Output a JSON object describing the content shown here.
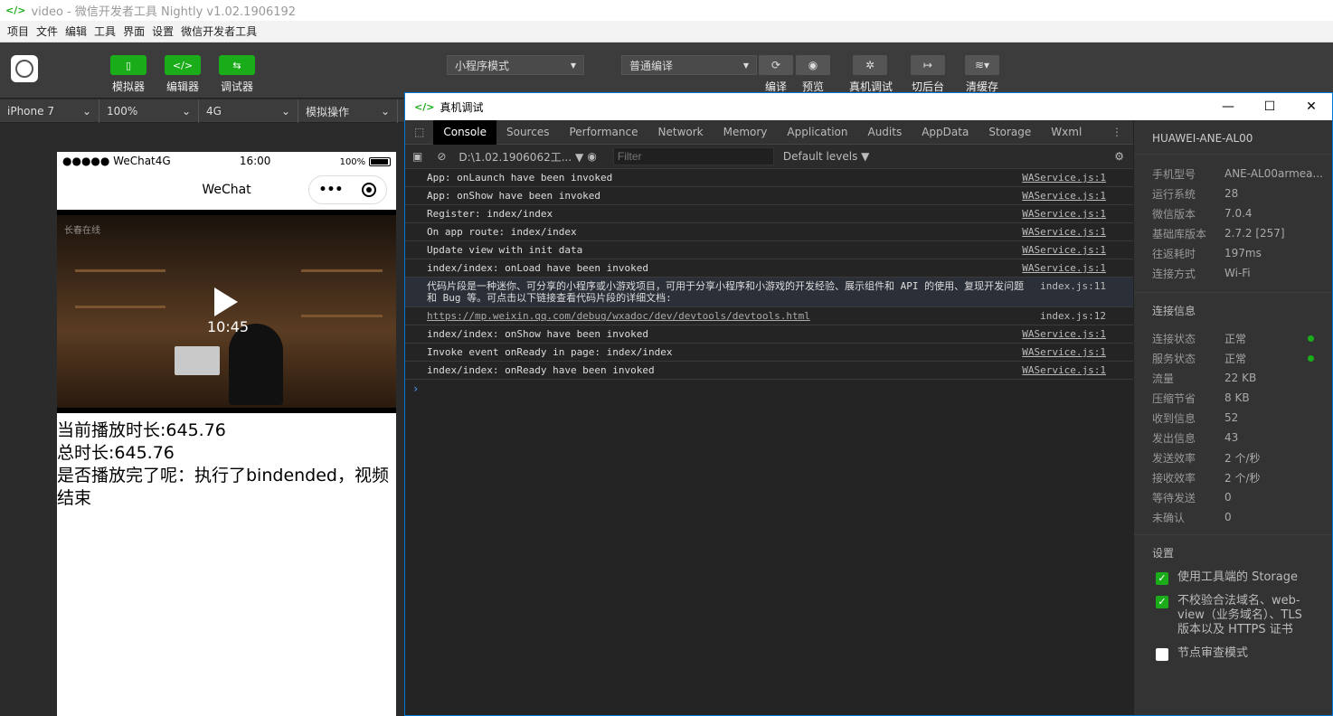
{
  "window": {
    "title": "video - 微信开发者工具 Nightly v1.02.1906192"
  },
  "menu": [
    "项目",
    "文件",
    "编辑",
    "工具",
    "界面",
    "设置",
    "微信开发者工具"
  ],
  "toolbar": {
    "simulator": "模拟器",
    "editor": "编辑器",
    "debugger": "调试器",
    "mode": "小程序模式",
    "compile_mode": "普通编译",
    "compile": "编译",
    "preview": "预览",
    "remote_debug": "真机调试",
    "background": "切后台",
    "clear_cache": "清缓存"
  },
  "device_bar": {
    "device": "iPhone 7",
    "zoom": "100%",
    "network": "4G",
    "simulate": "模拟操作"
  },
  "phone": {
    "status_left": "●●●●● WeChat4G",
    "time": "16:00",
    "battery": "100%",
    "nav_title": "WeChat",
    "capsule_dots": "•••",
    "video_watermark": "长春在线",
    "video_time": "10:45",
    "lines": [
      "当前播放时长:645.76",
      "总时长:645.76",
      "是否播放完了呢：执行了bindended，视频结束"
    ]
  },
  "devtools": {
    "title": "真机调试",
    "tabs": [
      "Console",
      "Sources",
      "Performance",
      "Network",
      "Memory",
      "Application",
      "Audits",
      "AppData",
      "Storage",
      "Wxml"
    ],
    "context": "D:\\1.02.1906062工...",
    "filter_placeholder": "Filter",
    "levels": "Default levels ▼",
    "logs": [
      {
        "msg": "App: onLaunch have been invoked",
        "src": "WAService.js:1"
      },
      {
        "msg": "App: onShow have been invoked",
        "src": "WAService.js:1"
      },
      {
        "msg": "Register: index/index",
        "src": "WAService.js:1"
      },
      {
        "msg": "On app route: index/index",
        "src": "WAService.js:1"
      },
      {
        "msg": "Update view with init data",
        "src": "WAService.js:1"
      },
      {
        "msg": "index/index: onLoad have been invoked",
        "src": "WAService.js:1"
      },
      {
        "msg": "代码片段是一种迷你、可分享的小程序或小游戏项目，可用于分享小程序和小游戏的开发经验、展示组件和 API 的使用、复现开发问题和 Bug 等。可点击以下链接查看代码片段的详细文档:",
        "src": "index.js:11"
      },
      {
        "msg": "https://mp.weixin.qq.com/debug/wxadoc/dev/devtools/devtools.html",
        "src": "index.js:12"
      },
      {
        "msg": "index/index: onShow have been invoked",
        "src": "WAService.js:1"
      },
      {
        "msg": "Invoke event onReady in page: index/index",
        "src": "WAService.js:1"
      },
      {
        "msg": "index/index: onReady have been invoked",
        "src": "WAService.js:1"
      }
    ],
    "prompt": "›",
    "side": {
      "device_name": "HUAWEI-ANE-AL00",
      "info": [
        {
          "k": "手机型号",
          "v": "ANE-AL00armea..."
        },
        {
          "k": "运行系统",
          "v": "28"
        },
        {
          "k": "微信版本",
          "v": "7.0.4"
        },
        {
          "k": "基础库版本",
          "v": "2.7.2 [257]"
        },
        {
          "k": "往返耗时",
          "v": "197ms"
        },
        {
          "k": "连接方式",
          "v": "Wi-Fi"
        }
      ],
      "conn_title": "连接信息",
      "conn": [
        {
          "k": "连接状态",
          "v": "正常"
        },
        {
          "k": "服务状态",
          "v": "正常"
        },
        {
          "k": "流量",
          "v": "22 KB"
        },
        {
          "k": "压缩节省",
          "v": "8 KB"
        },
        {
          "k": "收到信息",
          "v": "52"
        },
        {
          "k": "发出信息",
          "v": "43"
        },
        {
          "k": "发送效率",
          "v": "2 个/秒"
        },
        {
          "k": "接收效率",
          "v": "2 个/秒"
        },
        {
          "k": "等待发送",
          "v": "0"
        },
        {
          "k": "未确认",
          "v": "0"
        }
      ],
      "settings_title": "设置",
      "settings": [
        {
          "label": "使用工具端的 Storage",
          "checked": true
        },
        {
          "label": "不校验合法域名、web-view（业务域名）、TLS 版本以及 HTTPS 证书",
          "checked": true
        },
        {
          "label": "节点审查模式",
          "checked": false
        }
      ]
    }
  },
  "colors": {
    "accent": "#1aad19",
    "toolbar_bg": "#3c3c3c",
    "console_bg": "#242424"
  }
}
